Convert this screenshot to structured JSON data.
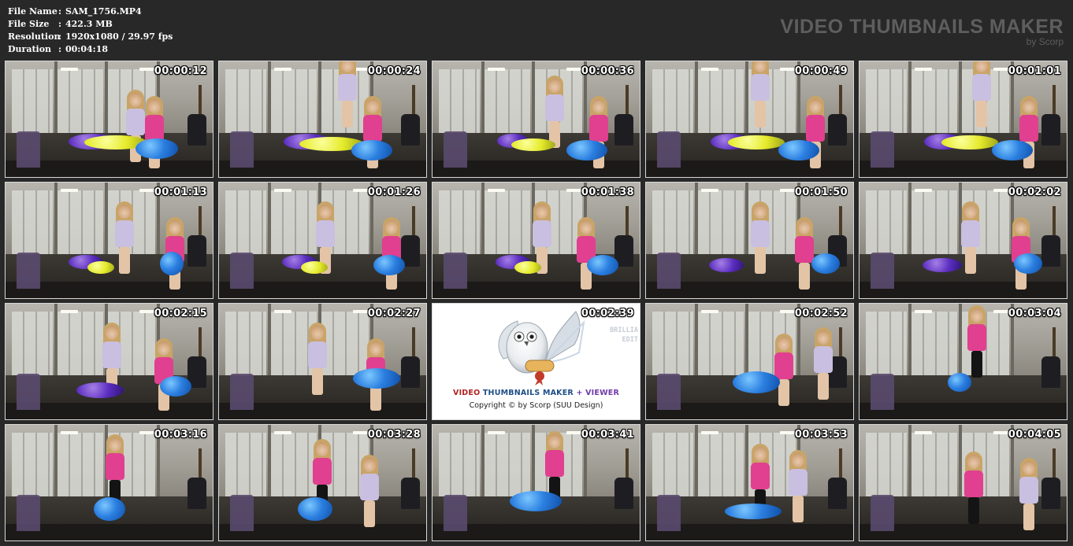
{
  "info": {
    "rows": [
      {
        "key": "File Name",
        "sep": ":",
        "value": "SAM_1756.MP4"
      },
      {
        "key": "File Size",
        "sep": ":",
        "value": "422.3 MB"
      },
      {
        "key": "Resolution",
        "sep": ":",
        "value": "1920x1080 / 29.97 fps"
      },
      {
        "key": "Duration",
        "sep": ":",
        "value": "00:04:18"
      }
    ]
  },
  "brand": {
    "title": "VIDEO THUMBNAILS MAKER",
    "subtitle": "by Scorp"
  },
  "thumbnails": [
    {
      "time": "00:00:12"
    },
    {
      "time": "00:00:24"
    },
    {
      "time": "00:00:36"
    },
    {
      "time": "00:00:49"
    },
    {
      "time": "00:01:01"
    },
    {
      "time": "00:01:13"
    },
    {
      "time": "00:01:26"
    },
    {
      "time": "00:01:38"
    },
    {
      "time": "00:01:50"
    },
    {
      "time": "00:02:02"
    },
    {
      "time": "00:02:15"
    },
    {
      "time": "00:02:27"
    },
    {
      "time": "00:02:39"
    },
    {
      "time": "00:02:52"
    },
    {
      "time": "00:03:04"
    },
    {
      "time": "00:03:16"
    },
    {
      "time": "00:03:28"
    },
    {
      "time": "00:03:41"
    },
    {
      "time": "00:03:53"
    },
    {
      "time": "00:04:05"
    }
  ],
  "logo_card": {
    "title_part1": "VIDEO ",
    "title_part2": "THUMBNAILS MAKER",
    "title_part3": " + VIEWER",
    "copyright": "Copyright © by Scorp (SUU Design)",
    "side_line1": "BRILLIA",
    "side_line2": "EDIT"
  },
  "colors": {
    "background": "#282828",
    "brand_text": "#5e5e5e",
    "thumb_border": "#d8d8d8",
    "stamp_text": "#ffffff"
  }
}
